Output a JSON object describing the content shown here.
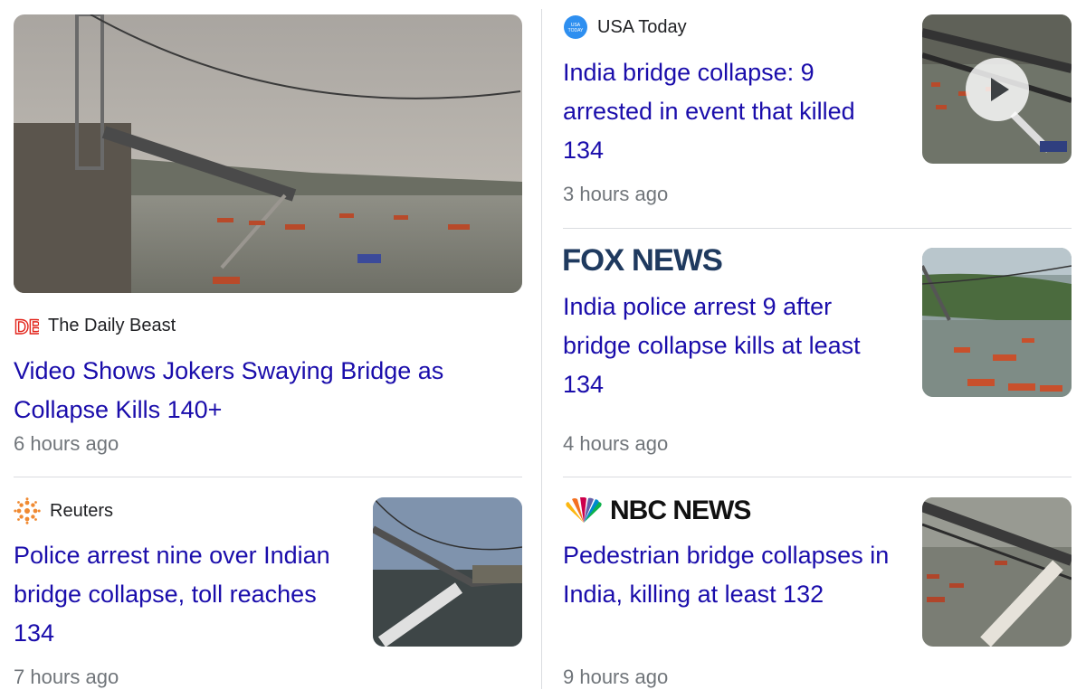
{
  "articles": [
    {
      "source": "The Daily Beast",
      "source_icon": "daily-beast-logo-icon",
      "headline": "Video Shows Jokers Swaying Bridge as Collapse Kills 140+",
      "time": "6 hours ago",
      "image": "bridge-collapse-photo"
    },
    {
      "source": "Reuters",
      "source_icon": "reuters-logo-icon",
      "headline": "Police arrest nine over Indian bridge collapse, toll reaches 134",
      "time": "7 hours ago",
      "image": "bridge-collapse-photo"
    },
    {
      "source": "USA Today",
      "source_icon": "usa-today-logo-icon",
      "headline": "India bridge collapse: 9 arrested in event that killed 134",
      "time": "3 hours ago",
      "image": "bridge-collapse-video-thumbnail",
      "has_video": true
    },
    {
      "source": "FOX NEWS",
      "source_icon": "fox-news-logo",
      "headline": "India police arrest 9 after bridge collapse kills at least 134",
      "time": "4 hours ago",
      "image": "rescue-boats-photo"
    },
    {
      "source": "NBC NEWS",
      "source_icon": "nbc-news-logo",
      "headline": "Pedestrian bridge collapses in India, killing at least 132",
      "time": "9 hours ago",
      "image": "bridge-collapse-photo"
    }
  ],
  "colors": {
    "link": "#1a0dab",
    "meta": "#70757a",
    "divider": "#dadce0",
    "daily_beast_red": "#e2231a",
    "fox_navy": "#1f3a5f"
  }
}
